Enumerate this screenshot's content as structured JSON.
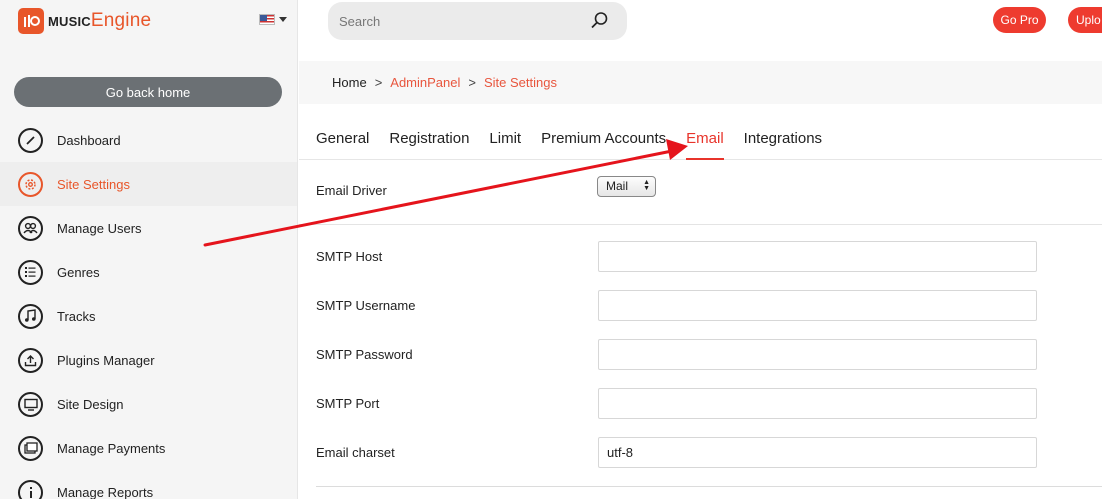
{
  "brand": {
    "name_part1": "MUSIC",
    "name_part2": "Engine"
  },
  "language": {
    "icon": "us-flag-icon"
  },
  "sidebar": {
    "home_button": "Go back home",
    "items": [
      {
        "label": "Dashboard",
        "icon": "dashboard-gauge-icon"
      },
      {
        "label": "Site Settings",
        "icon": "settings-gear-icon",
        "active": true
      },
      {
        "label": "Manage Users",
        "icon": "users-icon"
      },
      {
        "label": "Genres",
        "icon": "list-icon"
      },
      {
        "label": "Tracks",
        "icon": "music-note-icon"
      },
      {
        "label": "Plugins Manager",
        "icon": "upload-icon"
      },
      {
        "label": "Site Design",
        "icon": "monitor-icon"
      },
      {
        "label": "Manage Payments",
        "icon": "windows-icon"
      },
      {
        "label": "Manage Reports",
        "icon": "info-icon"
      }
    ]
  },
  "header": {
    "search_placeholder": "Search",
    "go_pro": "Go Pro",
    "upload": "Uplo"
  },
  "breadcrumb": {
    "home": "Home",
    "separator": ">",
    "admin": "AdminPanel",
    "current": "Site Settings"
  },
  "tabs": [
    {
      "label": "General"
    },
    {
      "label": "Registration"
    },
    {
      "label": "Limit"
    },
    {
      "label": "Premium Accounts"
    },
    {
      "label": "Email",
      "active": true
    },
    {
      "label": "Integrations"
    }
  ],
  "form": {
    "email_driver": {
      "label": "Email Driver",
      "value": "Mail"
    },
    "smtp_host": {
      "label": "SMTP Host",
      "value": ""
    },
    "smtp_username": {
      "label": "SMTP Username",
      "value": ""
    },
    "smtp_password": {
      "label": "SMTP Password",
      "value": ""
    },
    "smtp_port": {
      "label": "SMTP Port",
      "value": ""
    },
    "email_charset": {
      "label": "Email charset",
      "value": "utf-8"
    }
  },
  "colors": {
    "accent": "#e8562a",
    "tab_active": "#e8342b",
    "button_red": "#ee3b2f",
    "home_button": "#6b7074",
    "annotation_arrow": "#e5141c"
  }
}
